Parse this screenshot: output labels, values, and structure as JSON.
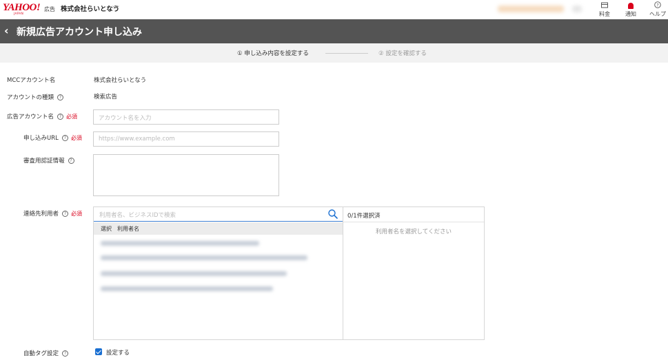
{
  "header": {
    "logo_text": "YAHOO!",
    "logo_sub": "JAPAN",
    "logo_ad": "広告",
    "company": "株式会社らいとなう",
    "icons": [
      {
        "name": "fee",
        "label": "料金",
        "icon": "wallet-icon"
      },
      {
        "name": "notify",
        "label": "通知",
        "icon": "bell-icon"
      },
      {
        "name": "help",
        "label": "ヘルプ",
        "icon": "help-icon"
      }
    ]
  },
  "title_bar": {
    "back_icon": "chevron-left-icon",
    "title": "新規広告アカウント申し込み"
  },
  "stepper": {
    "step1": "① 申し込み内容を設定する",
    "step2": "② 設定を確認する"
  },
  "form": {
    "mcc_label": "MCCアカウント名",
    "mcc_value": "株式会社らいとなう",
    "type_label": "アカウントの種類",
    "type_value": "検索広告",
    "name_label": "広告アカウント名",
    "name_placeholder": "アカウント名を入力",
    "url_label": "申し込みURL",
    "url_placeholder": "https://www.example.com",
    "review_label": "審査用認証情報",
    "contact_label": "連絡先利用者",
    "required_text": "必須",
    "help_glyph": "?",
    "autotag_label": "自動タグ設定",
    "autotag_option": "設定する"
  },
  "user_picker": {
    "search_placeholder": "利用者名、ビジネスIDで検索",
    "col_select": "選択",
    "col_user": "利用者名",
    "selected_count": "0/1件選択済",
    "empty_message": "利用者名を選択してください"
  },
  "colors": {
    "accent": "#d9001b",
    "titlebar": "#545454",
    "link_blue": "#1a6fd1"
  }
}
